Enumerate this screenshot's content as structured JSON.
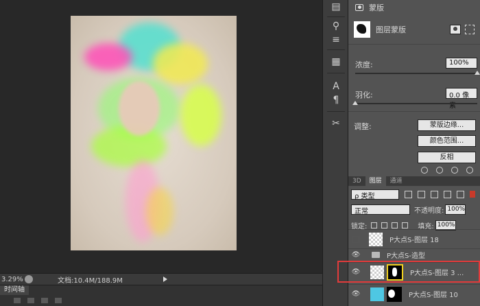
{
  "status_bar": {
    "zoom": "3.29%",
    "doc_info": "文档:10.4M/188.9M"
  },
  "timeline": {
    "tab_label": "时间轴"
  },
  "masks_panel": {
    "title": "蒙版",
    "layer_mask_label": "图层蒙版",
    "density": {
      "label": "浓度:",
      "value": "100%",
      "level_percent": 100
    },
    "feather": {
      "label": "羽化:",
      "value": "0.0 像素",
      "level_percent": 0
    },
    "refine_label": "调整:",
    "buttons": {
      "mask_edge": "蒙版边缘...",
      "color_range": "颜色范围...",
      "invert": "反相"
    }
  },
  "layers_panel": {
    "tabs": [
      "3D",
      "图层",
      "通道"
    ],
    "active_tab": "图层",
    "filter_select": "ρ 类型",
    "blend_mode": "正常",
    "opacity_label": "不透明度:",
    "opacity_value": "100%",
    "lock_label": "锁定:",
    "fill_label": "填充:",
    "fill_value": "100%",
    "layers": [
      {
        "name": "P大点S-图层 18",
        "visible": false
      },
      {
        "name": "P大点S-造型",
        "visible": true,
        "group": true
      },
      {
        "name": "P大点S-图层 3 ...",
        "visible": true,
        "selected": true
      },
      {
        "name": "P大点S-图层 10",
        "visible": true
      }
    ]
  },
  "colors": {
    "highlight_red": "#e23b3b",
    "mask_outline_yellow": "#f0d020"
  }
}
